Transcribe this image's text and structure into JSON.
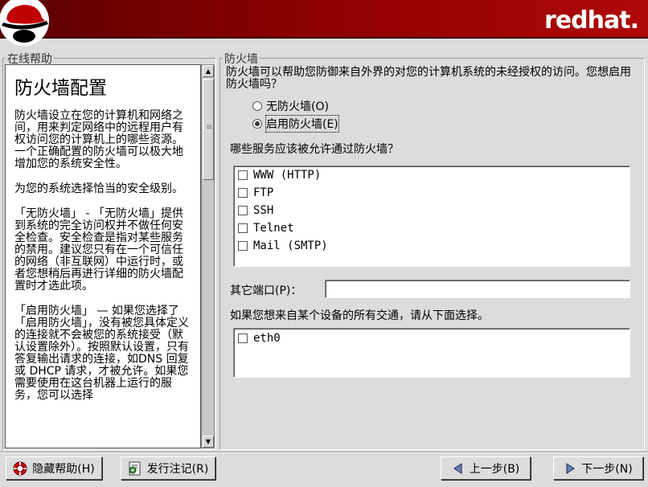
{
  "header": {
    "brand": "redhat."
  },
  "help": {
    "section_label": "在线帮助",
    "title": "防火墙配置",
    "paragraphs": [
      "防火墙设立在您的计算机和网络之间，用来判定网络中的远程用户有权访问您的计算机上的哪些资源。一个正确配置的防火墙可以极大地增加您的系统安全性。",
      "为您的系统选择恰当的安全级别。",
      "「无防火墙」 - 「无防火墙」提供到系统的完全访问权并不做任何安全检查。安全检查是指对某些服务的禁用。建议您只有在一个可信任的网络（非互联网）中运行时，或者您想稍后再进行详细的防火墙配置时才选此项。",
      "「启用防火墙」 — 如果您选择了「启用防火墙」，没有被您具体定义的连接就不会被您的系统接受（默认设置除外）。按照默认设置，只有答复输出请求的连接，如DNS 回复或 DHCP 请求，才被允许。如果您需要使用在这台机器上运行的服务，您可以选择"
    ]
  },
  "firewall": {
    "section_label": "防火墙",
    "question": "防火墙可以帮助您防御来自外界的对您的计算机系统的未经授权的访问。您想启用防火墙吗？",
    "options": [
      {
        "label": "无防火墙(O)",
        "selected": false
      },
      {
        "label": "启用防火墙(E)",
        "selected": true
      }
    ],
    "services_question": "哪些服务应该被允许通过防火墙？",
    "services": [
      {
        "label": "WWW (HTTP)",
        "checked": false
      },
      {
        "label": "FTP",
        "checked": false
      },
      {
        "label": "SSH",
        "checked": false
      },
      {
        "label": "Telnet",
        "checked": false
      },
      {
        "label": "Mail (SMTP)",
        "checked": false
      }
    ],
    "other_ports_label": "其它端口(P)：",
    "other_ports_value": "",
    "devices_question": "如果您想来自某个设备的所有交通，请从下面选择。",
    "devices": [
      {
        "label": "eth0",
        "checked": false
      }
    ]
  },
  "buttons": {
    "hide_help": "隐藏帮助(H)",
    "release_notes": "发行注记(R)",
    "back": "上一步(B)",
    "next": "下一步(N)"
  }
}
